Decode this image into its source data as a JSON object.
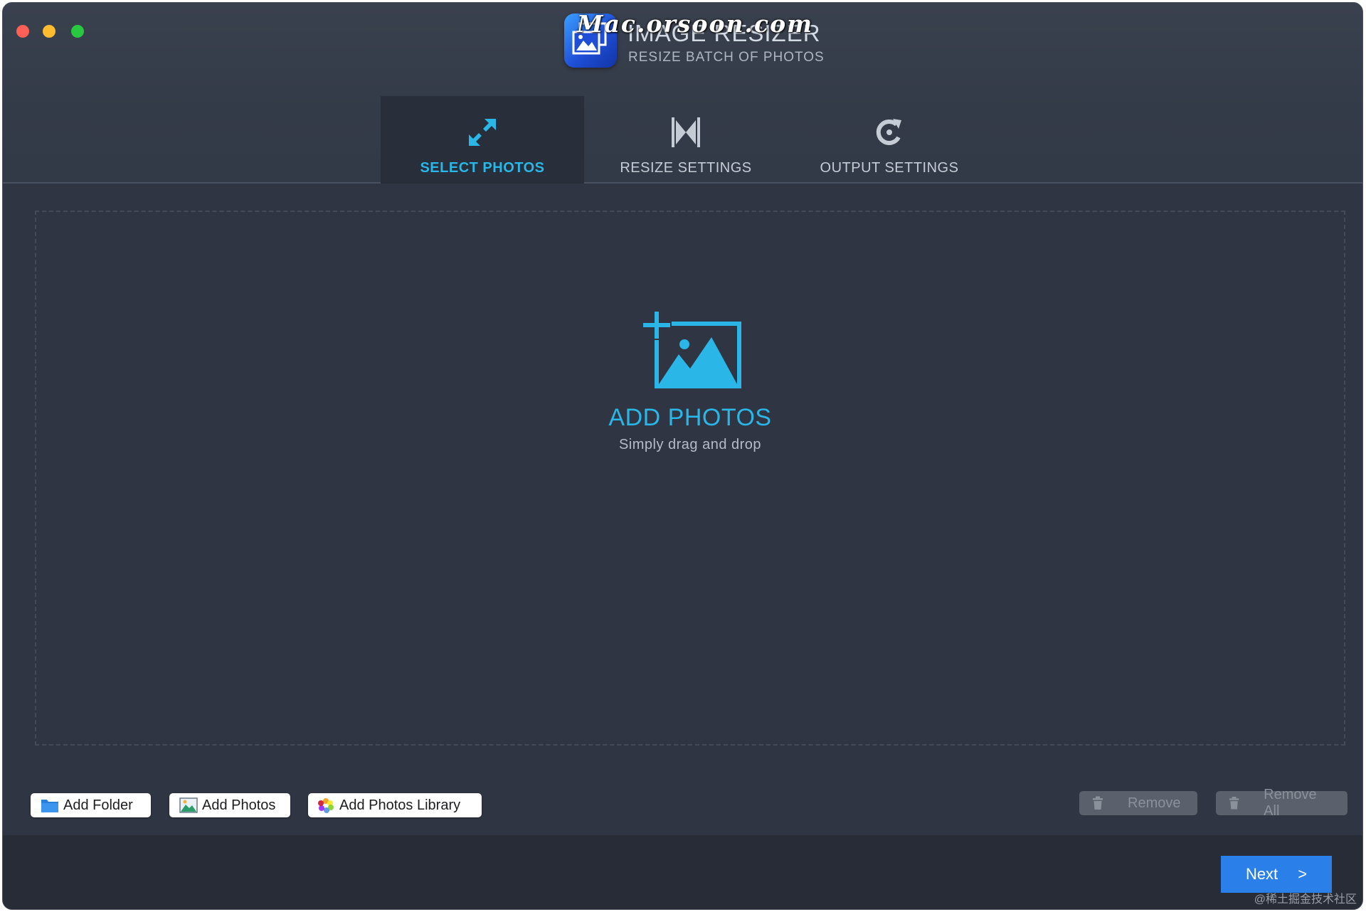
{
  "window": {
    "app_title": "IMAGE RESIZER",
    "app_subtitle": "RESIZE BATCH OF PHOTOS",
    "watermark": "Mac.orsoon.com"
  },
  "tabs": [
    {
      "label": "SELECT PHOTOS",
      "icon": "expand-arrows-icon",
      "active": true
    },
    {
      "label": "RESIZE SETTINGS",
      "icon": "resize-bowtie-icon",
      "active": false
    },
    {
      "label": "OUTPUT SETTINGS",
      "icon": "refresh-icon",
      "active": false
    }
  ],
  "dropzone": {
    "title": "ADD PHOTOS",
    "subtitle": "Simply drag and drop",
    "icon": "add-image-icon"
  },
  "toolbar": {
    "add_folder": "Add Folder",
    "add_photos": "Add Photos",
    "add_photos_library": "Add Photos Library",
    "remove": "Remove",
    "remove_all": "Remove All"
  },
  "footer": {
    "next_label": "Next",
    "next_chevron": ">",
    "credit": "@稀土掘金技术社区"
  },
  "colors": {
    "accent": "#2ab6e6",
    "primary_button": "#2a80e8",
    "background": "#2f3542"
  }
}
